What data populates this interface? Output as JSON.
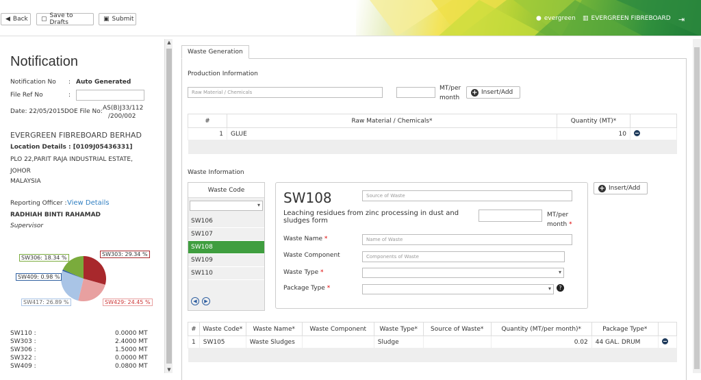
{
  "toolbar": {
    "back": "Back",
    "save": "Save to Drafts",
    "submit": "Submit"
  },
  "header": {
    "user": "evergreen",
    "company": "EVERGREEN FIBREBOARD"
  },
  "left": {
    "title": "Notification",
    "notif_label": "Notification No",
    "notif_value": "Auto Generated",
    "file_label": "File Ref No",
    "date": "Date: 22/05/2015",
    "doe_label": "DOE File No:",
    "doe_value_1": "AS(B)J33/112",
    "doe_value_2": "/200/002",
    "company": "EVERGREEN FIBREBOARD BERHAD",
    "location": "Location Details : [0109J05436331]",
    "addr1": "PLO 22,PARIT RAJA INDUSTRIAL ESTATE,",
    "addr2": "JOHOR",
    "addr3": "MALAYSIA",
    "officer_label": "Reporting Officer :",
    "officer_link": "View Details",
    "officer_name": "RADHIAH BINTI RAHAMAD",
    "officer_role": "Supervisor",
    "pie_labels": [
      "SW306: 18.34 %",
      "SW303: 29.34 %",
      "SW409: 0.98 %",
      "SW417: 26.89 %",
      "SW429: 24.45 %"
    ],
    "totals": [
      {
        "code": "SW110 :",
        "value": "0.0000 MT"
      },
      {
        "code": "SW303 :",
        "value": "2.4000 MT"
      },
      {
        "code": "SW306 :",
        "value": "1.5000 MT"
      },
      {
        "code": "SW322 :",
        "value": "0.0000 MT"
      },
      {
        "code": "SW409 :",
        "value": "0.0800 MT"
      }
    ]
  },
  "chart_data": {
    "type": "pie",
    "categories": [
      "SW303",
      "SW429",
      "SW417",
      "SW409",
      "SW306"
    ],
    "values": [
      29.34,
      24.45,
      26.89,
      0.98,
      18.34
    ],
    "colors": [
      "#a8282c",
      "#e8a0a0",
      "#a9c4e6",
      "#2f5fa0",
      "#7aab3c"
    ]
  },
  "main": {
    "tab": "Waste Generation",
    "prod_title": "Production Information",
    "raw_placeholder": "Raw Material / Chemicals",
    "mt_unit_1": "MT/per",
    "mt_unit_2": "month",
    "insert": "Insert/Add",
    "prod_headers": [
      "#",
      "Raw Material / Chemicals*",
      "Quantity (MT)*"
    ],
    "prod_rows": [
      {
        "no": "1",
        "name": "GLUE",
        "qty": "10"
      }
    ],
    "waste_title": "Waste Information",
    "wc_header": "Waste Code",
    "wc_items": [
      "SW106",
      "SW107",
      "SW108",
      "SW109",
      "SW110"
    ],
    "sw_code": "SW108",
    "sw_desc": "Leaching residues from zinc processing in dust and sludges form",
    "source_placeholder": "Source of Waste",
    "waste_name_label": "Waste Name",
    "waste_name_placeholder": "Name of Waste",
    "waste_comp_label": "Waste Component",
    "waste_comp_placeholder": "Components of Waste",
    "waste_type_label": "Waste Type",
    "package_label": "Package Type",
    "help": "?",
    "waste_headers": [
      "#",
      "Waste Code*",
      "Waste Name*",
      "Waste Component",
      "Waste Type*",
      "Source of Waste*",
      "Quantity (MT/per month)*",
      "Package Type*"
    ],
    "waste_rows": [
      {
        "no": "1",
        "code": "SW105",
        "name": "Waste Sludges",
        "comp": "",
        "type": "Sludge",
        "source": "",
        "qty": "0.02",
        "pkg": "44 GAL. DRUM"
      }
    ]
  }
}
